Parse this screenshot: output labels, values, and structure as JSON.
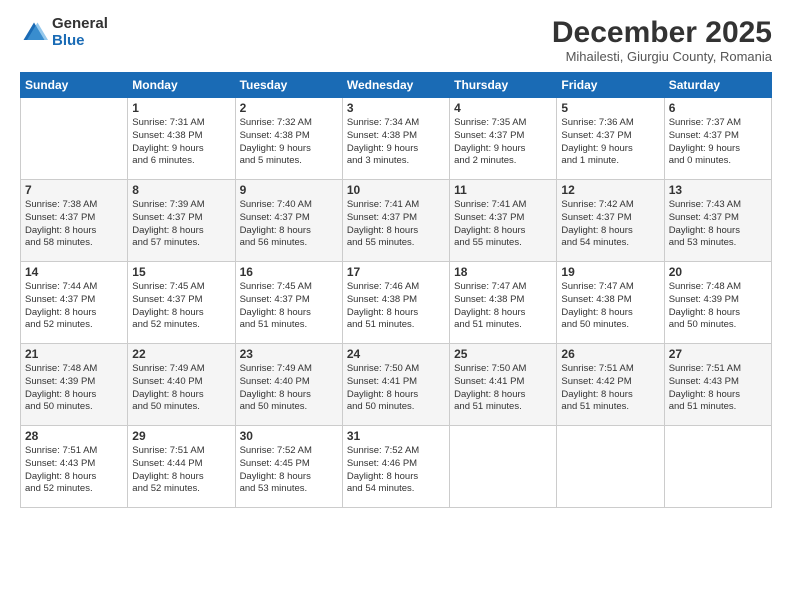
{
  "logo": {
    "general": "General",
    "blue": "Blue"
  },
  "header": {
    "month_title": "December 2025",
    "location": "Mihailesti, Giurgiu County, Romania"
  },
  "weekdays": [
    "Sunday",
    "Monday",
    "Tuesday",
    "Wednesday",
    "Thursday",
    "Friday",
    "Saturday"
  ],
  "weeks": [
    [
      {
        "day": "",
        "info": ""
      },
      {
        "day": "1",
        "info": "Sunrise: 7:31 AM\nSunset: 4:38 PM\nDaylight: 9 hours\nand 6 minutes."
      },
      {
        "day": "2",
        "info": "Sunrise: 7:32 AM\nSunset: 4:38 PM\nDaylight: 9 hours\nand 5 minutes."
      },
      {
        "day": "3",
        "info": "Sunrise: 7:34 AM\nSunset: 4:38 PM\nDaylight: 9 hours\nand 3 minutes."
      },
      {
        "day": "4",
        "info": "Sunrise: 7:35 AM\nSunset: 4:37 PM\nDaylight: 9 hours\nand 2 minutes."
      },
      {
        "day": "5",
        "info": "Sunrise: 7:36 AM\nSunset: 4:37 PM\nDaylight: 9 hours\nand 1 minute."
      },
      {
        "day": "6",
        "info": "Sunrise: 7:37 AM\nSunset: 4:37 PM\nDaylight: 9 hours\nand 0 minutes."
      }
    ],
    [
      {
        "day": "7",
        "info": "Sunrise: 7:38 AM\nSunset: 4:37 PM\nDaylight: 8 hours\nand 58 minutes."
      },
      {
        "day": "8",
        "info": "Sunrise: 7:39 AM\nSunset: 4:37 PM\nDaylight: 8 hours\nand 57 minutes."
      },
      {
        "day": "9",
        "info": "Sunrise: 7:40 AM\nSunset: 4:37 PM\nDaylight: 8 hours\nand 56 minutes."
      },
      {
        "day": "10",
        "info": "Sunrise: 7:41 AM\nSunset: 4:37 PM\nDaylight: 8 hours\nand 55 minutes."
      },
      {
        "day": "11",
        "info": "Sunrise: 7:41 AM\nSunset: 4:37 PM\nDaylight: 8 hours\nand 55 minutes."
      },
      {
        "day": "12",
        "info": "Sunrise: 7:42 AM\nSunset: 4:37 PM\nDaylight: 8 hours\nand 54 minutes."
      },
      {
        "day": "13",
        "info": "Sunrise: 7:43 AM\nSunset: 4:37 PM\nDaylight: 8 hours\nand 53 minutes."
      }
    ],
    [
      {
        "day": "14",
        "info": "Sunrise: 7:44 AM\nSunset: 4:37 PM\nDaylight: 8 hours\nand 52 minutes."
      },
      {
        "day": "15",
        "info": "Sunrise: 7:45 AM\nSunset: 4:37 PM\nDaylight: 8 hours\nand 52 minutes."
      },
      {
        "day": "16",
        "info": "Sunrise: 7:45 AM\nSunset: 4:37 PM\nDaylight: 8 hours\nand 51 minutes."
      },
      {
        "day": "17",
        "info": "Sunrise: 7:46 AM\nSunset: 4:38 PM\nDaylight: 8 hours\nand 51 minutes."
      },
      {
        "day": "18",
        "info": "Sunrise: 7:47 AM\nSunset: 4:38 PM\nDaylight: 8 hours\nand 51 minutes."
      },
      {
        "day": "19",
        "info": "Sunrise: 7:47 AM\nSunset: 4:38 PM\nDaylight: 8 hours\nand 50 minutes."
      },
      {
        "day": "20",
        "info": "Sunrise: 7:48 AM\nSunset: 4:39 PM\nDaylight: 8 hours\nand 50 minutes."
      }
    ],
    [
      {
        "day": "21",
        "info": "Sunrise: 7:48 AM\nSunset: 4:39 PM\nDaylight: 8 hours\nand 50 minutes."
      },
      {
        "day": "22",
        "info": "Sunrise: 7:49 AM\nSunset: 4:40 PM\nDaylight: 8 hours\nand 50 minutes."
      },
      {
        "day": "23",
        "info": "Sunrise: 7:49 AM\nSunset: 4:40 PM\nDaylight: 8 hours\nand 50 minutes."
      },
      {
        "day": "24",
        "info": "Sunrise: 7:50 AM\nSunset: 4:41 PM\nDaylight: 8 hours\nand 50 minutes."
      },
      {
        "day": "25",
        "info": "Sunrise: 7:50 AM\nSunset: 4:41 PM\nDaylight: 8 hours\nand 51 minutes."
      },
      {
        "day": "26",
        "info": "Sunrise: 7:51 AM\nSunset: 4:42 PM\nDaylight: 8 hours\nand 51 minutes."
      },
      {
        "day": "27",
        "info": "Sunrise: 7:51 AM\nSunset: 4:43 PM\nDaylight: 8 hours\nand 51 minutes."
      }
    ],
    [
      {
        "day": "28",
        "info": "Sunrise: 7:51 AM\nSunset: 4:43 PM\nDaylight: 8 hours\nand 52 minutes."
      },
      {
        "day": "29",
        "info": "Sunrise: 7:51 AM\nSunset: 4:44 PM\nDaylight: 8 hours\nand 52 minutes."
      },
      {
        "day": "30",
        "info": "Sunrise: 7:52 AM\nSunset: 4:45 PM\nDaylight: 8 hours\nand 53 minutes."
      },
      {
        "day": "31",
        "info": "Sunrise: 7:52 AM\nSunset: 4:46 PM\nDaylight: 8 hours\nand 54 minutes."
      },
      {
        "day": "",
        "info": ""
      },
      {
        "day": "",
        "info": ""
      },
      {
        "day": "",
        "info": ""
      }
    ]
  ]
}
